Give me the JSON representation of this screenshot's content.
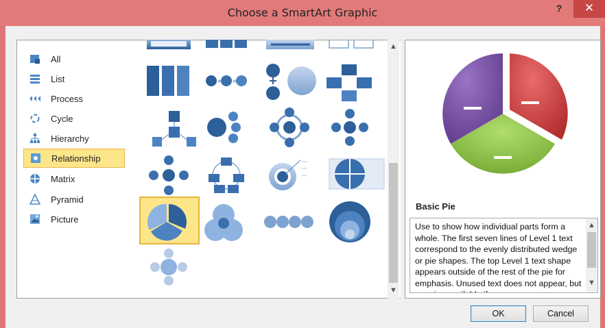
{
  "window": {
    "title": "Choose a SmartArt Graphic",
    "help_glyph": "?",
    "close_glyph": "✕"
  },
  "categories": [
    {
      "label": "All",
      "icon": "all-icon"
    },
    {
      "label": "List",
      "icon": "list-icon"
    },
    {
      "label": "Process",
      "icon": "process-icon"
    },
    {
      "label": "Cycle",
      "icon": "cycle-icon"
    },
    {
      "label": "Hierarchy",
      "icon": "hierarchy-icon"
    },
    {
      "label": "Relationship",
      "icon": "relationship-icon",
      "selected": true
    },
    {
      "label": "Matrix",
      "icon": "matrix-icon"
    },
    {
      "label": "Pyramid",
      "icon": "pyramid-icon"
    },
    {
      "label": "Picture",
      "icon": "picture-icon"
    }
  ],
  "gallery": {
    "selected": "Basic Pie",
    "scroll": {
      "up": "▲",
      "down": "▼"
    }
  },
  "preview": {
    "name": "Basic Pie",
    "description": "Use to show how individual parts form a whole. The first seven lines of Level 1 text correspond to the evenly distributed wedge or pie shapes. The top Level 1 text shape appears outside of the rest of the pie for emphasis. Unused text does not appear, but remains available if",
    "colors": {
      "red": "#cf3b3b",
      "purple": "#7a4fa5",
      "green": "#8cc63f"
    }
  },
  "buttons": {
    "ok": "OK",
    "cancel": "Cancel"
  }
}
